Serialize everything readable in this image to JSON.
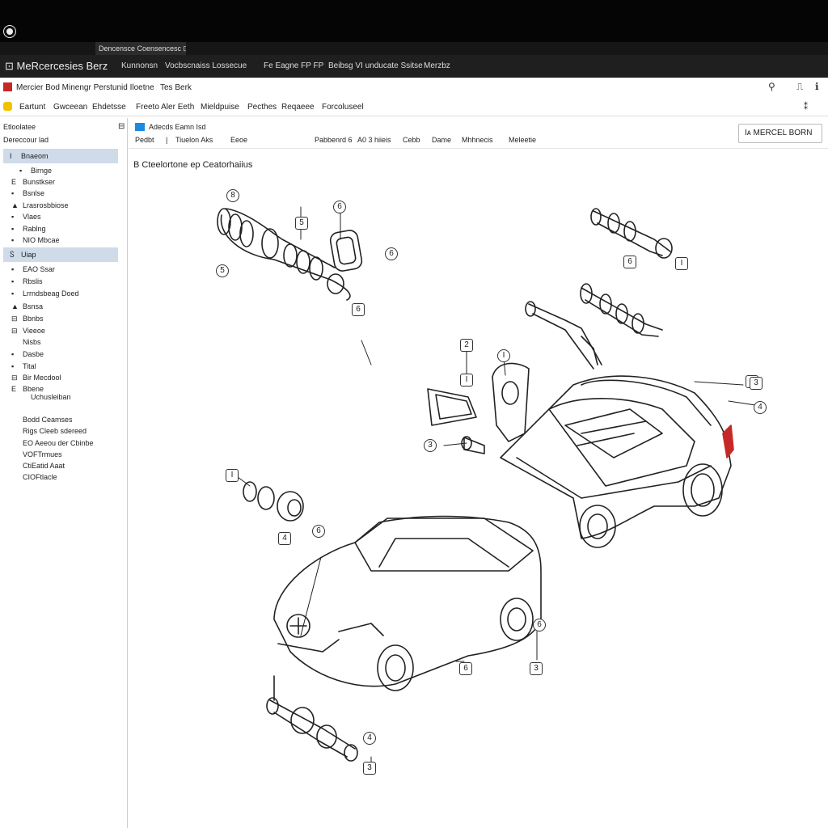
{
  "window": {
    "tab_label": "Dencensce Coensencesc ⊡"
  },
  "app": {
    "brand": "MeRcercesies Berz",
    "nav": [
      "Kunnonsn",
      "Vocbscnaiss Lossecue",
      "Fe Eagne FP FP",
      "Beibsg VI unducate Ssitse",
      "Merzbz"
    ]
  },
  "menubar": {
    "title": "Mercier Bod Minengr Perstunid Iloetne",
    "secondary": "Tes Berk"
  },
  "toolbar": {
    "items": [
      "Eartunt",
      "Gwceean",
      "Ehdetsse",
      "Freeto Aler Eeth",
      "Mieldpuise",
      "Pecthes",
      "Reqaeee",
      "Forcoluseel"
    ]
  },
  "sidebar": {
    "header": "Etloolatee",
    "subheader": "Dereccour lad",
    "items": [
      {
        "icon": "I",
        "label": "Bnaeom",
        "selected": true
      },
      {
        "icon": "▪",
        "label": "Birnge",
        "selected": false
      },
      {
        "icon": "E",
        "label": "Bunstkser",
        "selected": false
      },
      {
        "icon": "▪",
        "label": "Bsnlse",
        "selected": false
      },
      {
        "icon": "▲",
        "label": "Lrasrosbbiose",
        "selected": false
      },
      {
        "icon": "▪",
        "label": "Vlaes",
        "selected": false
      },
      {
        "icon": "▪",
        "label": "Rablng",
        "selected": false
      },
      {
        "icon": "▪",
        "label": "NIO Mbcae",
        "selected": false
      },
      {
        "icon": "Ⴝ",
        "label": "Uiap",
        "selected": true
      },
      {
        "icon": "▪",
        "label": "EAO Ssar",
        "selected": false
      },
      {
        "icon": "▪",
        "label": "Rbslis",
        "selected": false
      },
      {
        "icon": "▪",
        "label": "Lrrndsbeag Doed",
        "selected": false
      },
      {
        "icon": "▲",
        "label": "Bsnsa",
        "selected": false
      },
      {
        "icon": "⊟",
        "label": "Bbnbs",
        "selected": false
      },
      {
        "icon": "⊟",
        "label": "Vieeoe",
        "selected": false
      },
      {
        "icon": "",
        "label": "Nisbs",
        "selected": false
      },
      {
        "icon": "▪",
        "label": "Dasbe",
        "selected": false
      },
      {
        "icon": "▪",
        "label": "Tital",
        "selected": false
      },
      {
        "icon": "⊟",
        "label": "Bir Mecdool",
        "selected": false
      },
      {
        "icon": "E",
        "label": "Bbene",
        "selected": false
      },
      {
        "icon": "",
        "label": "Uchusleiban",
        "selected": false
      },
      {
        "icon": "",
        "label": "Bodd Ceamses",
        "selected": false
      },
      {
        "icon": "",
        "label": "Rigs Cleeb sdereed",
        "selected": false
      },
      {
        "icon": "",
        "label": "EO Aeeou der Cbinbe",
        "selected": false
      },
      {
        "icon": "",
        "label": "VOFTrmues",
        "selected": false
      },
      {
        "icon": "",
        "label": "CtiEatid Aaat",
        "selected": false
      },
      {
        "icon": "",
        "label": "CIOFtlacle",
        "selected": false
      }
    ]
  },
  "main": {
    "toolbar": {
      "heading": "Adecds Eamn  Isd",
      "left": [
        "Pedbt",
        "Tiuelon  Aks",
        "Eeoe"
      ],
      "right": [
        "Pabbenrd 6",
        "A0 3 hiieis",
        "Cebb",
        "Dame",
        "Mhhnecis",
        "Meleetie"
      ],
      "box_label": "Iᴀ  MERCEL BORN"
    },
    "section_title": "B  Cteelortone ep Ceatorhaiius",
    "callouts": [
      "8",
      "5",
      "5",
      "6",
      "6",
      "6",
      "6",
      "I",
      "I",
      "2",
      "I",
      "I",
      "4",
      "3",
      "I",
      "4",
      "6",
      "6",
      "6",
      "3",
      "4",
      "3",
      "3"
    ]
  }
}
